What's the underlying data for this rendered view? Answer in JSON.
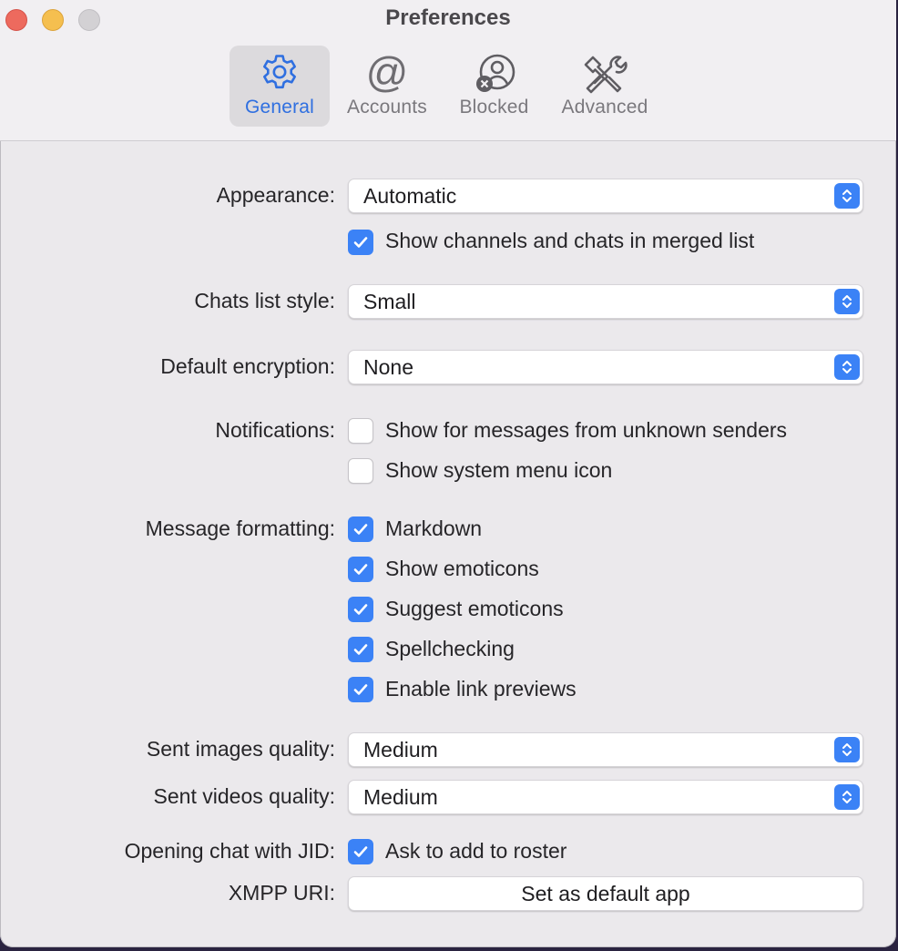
{
  "window": {
    "title": "Preferences"
  },
  "tabs": [
    {
      "label": "General",
      "icon": "gear-icon",
      "selected": true
    },
    {
      "label": "Accounts",
      "icon": "at-sign-icon",
      "selected": false
    },
    {
      "label": "Blocked",
      "icon": "blocked-user-icon",
      "selected": false
    },
    {
      "label": "Advanced",
      "icon": "tools-icon",
      "selected": false
    }
  ],
  "appearance": {
    "label": "Appearance:",
    "value": "Automatic",
    "merged_list_checked": true,
    "merged_list_label": "Show channels and chats in merged list"
  },
  "chats_list_style": {
    "label": "Chats list style:",
    "value": "Small"
  },
  "default_encryption": {
    "label": "Default encryption:",
    "value": "None"
  },
  "notifications": {
    "label": "Notifications:",
    "unknown_senders_label": "Show for messages from unknown senders",
    "unknown_senders_checked": false,
    "system_menu_label": "Show system menu icon",
    "system_menu_checked": false
  },
  "message_formatting": {
    "label": "Message formatting:",
    "markdown": "Markdown",
    "show_emoticons": "Show emoticons",
    "suggest_emoticons": "Suggest emoticons",
    "spellchecking": "Spellchecking",
    "link_previews": "Enable link previews",
    "all_checked": true
  },
  "sent_images": {
    "label": "Sent images quality:",
    "value": "Medium"
  },
  "sent_videos": {
    "label": "Sent videos quality:",
    "value": "Medium"
  },
  "opening_chat": {
    "label": "Opening chat with JID:",
    "checkbox_label": "Ask to add to roster",
    "checked": true
  },
  "xmpp_uri": {
    "label": "XMPP URI:",
    "button_label": "Set as default app"
  },
  "colors": {
    "accent": "#3b82f6",
    "selected_tab_text": "#2f6fe0",
    "window_bg": "#ebe9ec"
  }
}
